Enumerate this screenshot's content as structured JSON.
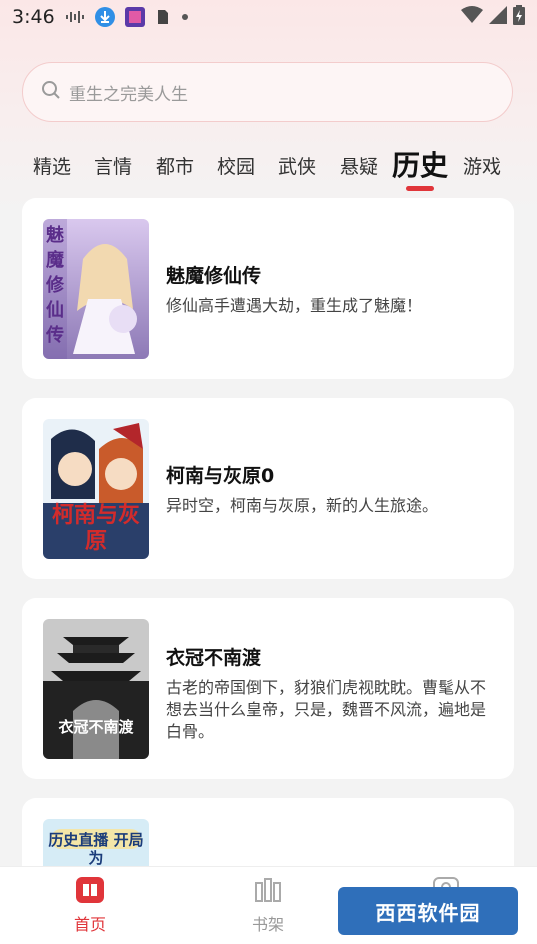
{
  "status_bar": {
    "time": "3:46"
  },
  "search": {
    "placeholder": "重生之完美人生"
  },
  "tabs": [
    {
      "label": "精选"
    },
    {
      "label": "言情"
    },
    {
      "label": "都市"
    },
    {
      "label": "校园"
    },
    {
      "label": "武侠"
    },
    {
      "label": "悬疑"
    },
    {
      "label": "历史"
    },
    {
      "label": "游戏"
    }
  ],
  "active_tab": "历史",
  "books": [
    {
      "title": "魅魔修仙传",
      "desc": "修仙高手遭遇大劫，重生成了魅魔！",
      "cover_text": "魅魔修仙传",
      "cover_icon": "anime-girl-cover"
    },
    {
      "title": "柯南与灰原0",
      "desc": "异时空，柯南与灰原，新的人生旅途。",
      "cover_text": "柯南与灰原",
      "cover_icon": "anime-duo-cover"
    },
    {
      "title": "衣冠不南渡",
      "desc": "古老的帝国倒下，豺狼们虎视眈眈。曹髦从不想去当什么皇帝，只是，魏晋不风流，遍地是白骨。",
      "cover_text": "衣冠不南渡",
      "cover_icon": "pagoda-cover"
    },
    {
      "title": "",
      "desc": "",
      "cover_text": "历史直播 开局为",
      "cover_icon": "cartoon-cover"
    }
  ],
  "bottom_nav": {
    "home": "首页",
    "bookshelf": "书架",
    "profile": ""
  },
  "watermark": {
    "text": "西西软件园"
  },
  "colors": {
    "accent": "#e0353a",
    "background": "#f3f3f3",
    "card": "#ffffff"
  }
}
